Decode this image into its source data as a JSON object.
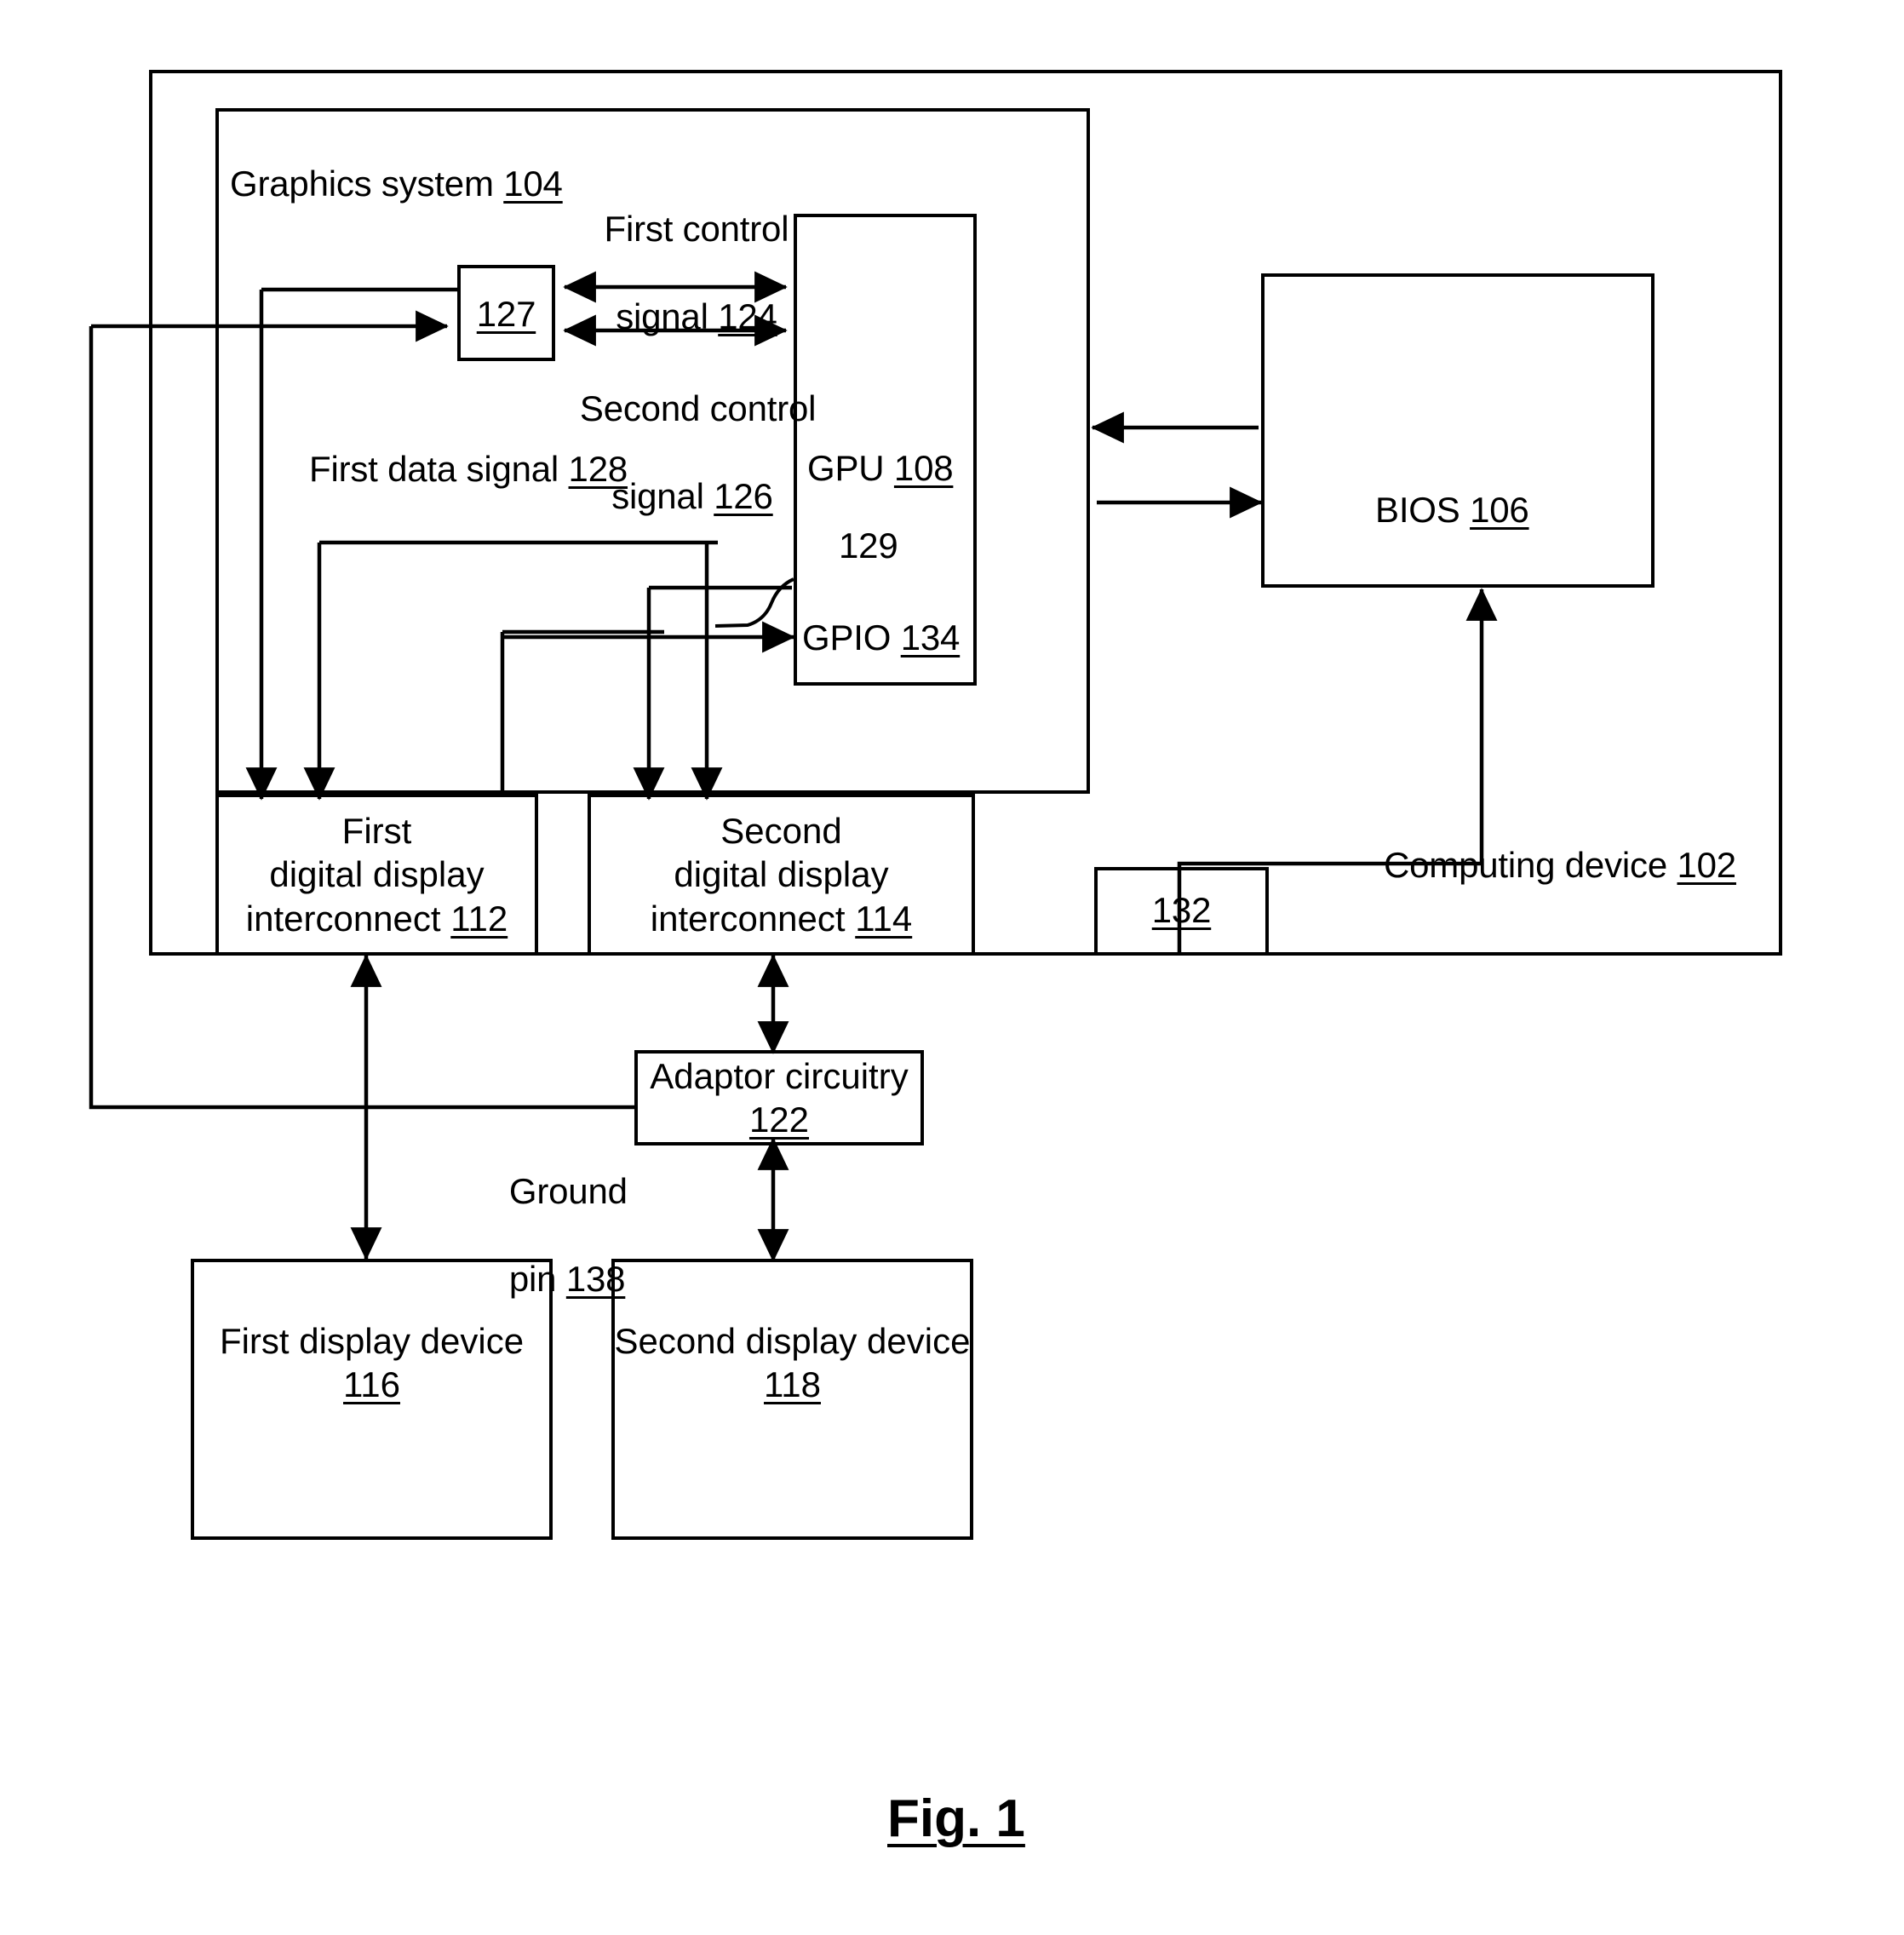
{
  "figure": {
    "caption": "Fig. 1"
  },
  "boxes": {
    "computing_device": {
      "label": "Computing device",
      "ref": "102"
    },
    "graphics_system": {
      "label": "Graphics system",
      "ref": "104"
    },
    "bios": {
      "label": "BIOS",
      "ref": "106"
    },
    "gpu": {
      "label": "GPU",
      "ref": "108"
    },
    "gpio": {
      "label": "GPIO",
      "ref": "134"
    },
    "switch_127": {
      "label": "",
      "ref": "127"
    },
    "node_132": {
      "label": "",
      "ref": "132"
    },
    "first_interconnect": {
      "line1": "First",
      "line2": "digital display",
      "line3": "interconnect",
      "ref": "112"
    },
    "second_interconnect": {
      "line1": "Second",
      "line2": "digital display",
      "line3": "interconnect",
      "ref": "114"
    },
    "adaptor": {
      "label": "Adaptor circuitry",
      "ref": "122"
    },
    "first_display": {
      "label": "First display device",
      "ref": "116"
    },
    "second_display": {
      "label": "Second display device",
      "ref": "118"
    }
  },
  "signals": {
    "first_control": {
      "line1": "First control",
      "line2": "signal",
      "ref": "124"
    },
    "second_control": {
      "line1": "Second control",
      "line2": "signal",
      "ref": "126"
    },
    "first_data": {
      "label": "First data signal",
      "ref": "128"
    },
    "ref_129": "129",
    "ground_pin": {
      "line1": "Ground",
      "line2": "pin",
      "ref": "138"
    }
  },
  "colors": {
    "ink": "#000000",
    "paper": "#ffffff"
  }
}
